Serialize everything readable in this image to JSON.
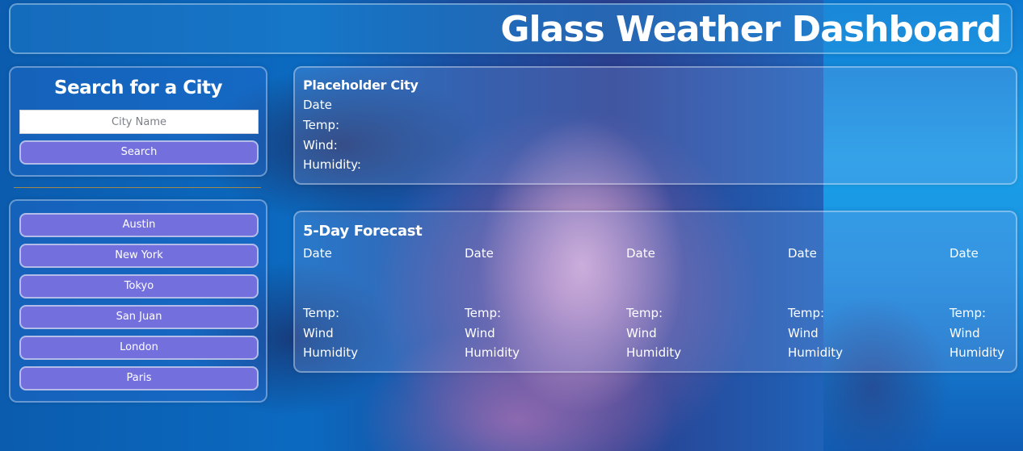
{
  "header": {
    "title": "Glass Weather Dashboard"
  },
  "search": {
    "title": "Search for a City",
    "placeholder": "City Name",
    "value": "",
    "button_label": "Search"
  },
  "history": {
    "cities": [
      "Austin",
      "New York",
      "Tokyo",
      "San Juan",
      "London",
      "Paris"
    ]
  },
  "current": {
    "city": "Placeholder City",
    "date": "Date",
    "temp": "Temp:",
    "wind": "Wind:",
    "humidity": "Humidity:"
  },
  "forecast": {
    "title": "5-Day Forecast",
    "days": [
      {
        "date": "Date",
        "temp": "Temp:",
        "wind": "Wind",
        "humidity": "Humidity"
      },
      {
        "date": "Date",
        "temp": "Temp:",
        "wind": "Wind",
        "humidity": "Humidity"
      },
      {
        "date": "Date",
        "temp": "Temp:",
        "wind": "Wind",
        "humidity": "Humidity"
      },
      {
        "date": "Date",
        "temp": "Temp:",
        "wind": "Wind",
        "humidity": "Humidity"
      },
      {
        "date": "Date",
        "temp": "Temp:",
        "wind": "Wind",
        "humidity": "Humidity"
      }
    ]
  },
  "colors": {
    "button": "#7370dd",
    "text": "#ffffff"
  }
}
